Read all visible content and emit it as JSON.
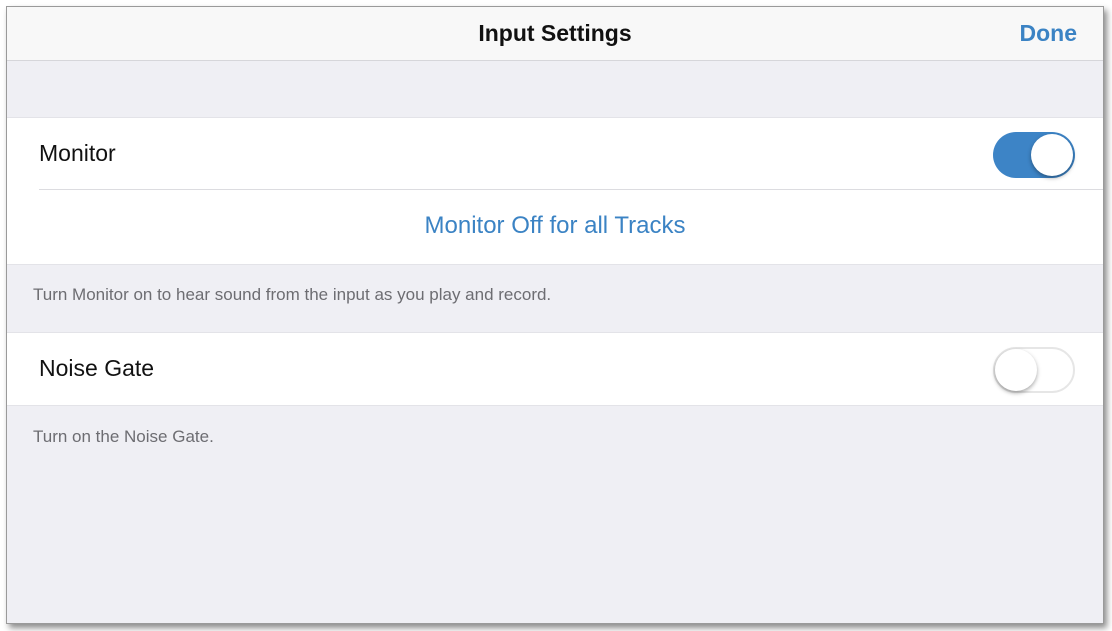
{
  "navbar": {
    "title": "Input Settings",
    "done_label": "Done"
  },
  "monitor_group": {
    "monitor_label": "Monitor",
    "monitor_on": true,
    "action_label": "Monitor Off for all Tracks",
    "footer": "Turn Monitor on to hear sound from the input as you play and record."
  },
  "noise_gate_group": {
    "label": "Noise Gate",
    "noise_gate_on": false,
    "footer": "Turn on the Noise Gate."
  },
  "colors": {
    "accent": "#3b83c4",
    "background": "#efeff4",
    "toggle_on": "#3d84c6"
  }
}
